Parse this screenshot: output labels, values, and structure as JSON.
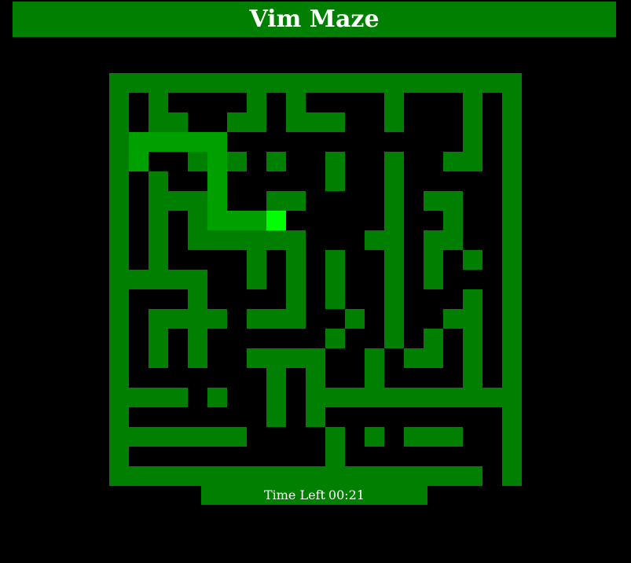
{
  "header": {
    "title": "Vim Maze"
  },
  "timer": {
    "label": "Time Left",
    "value": "00:21"
  },
  "maze": {
    "rows": 21,
    "cols": 21,
    "colors": {
      "wall": "#007f00",
      "floor": "#000000",
      "trail": "#00a000",
      "player": "#00ff00"
    },
    "grid": [
      "#####################",
      "#.#....#.#....#...#.#",
      "#.##..##.###..#...#.#",
      "#.................#.#",
      "#...###.#..#..#..##.#",
      "#.#........#..#.....#",
      "#.###...##....#.##..#",
      "#.#.#.........#..#..#",
      "#.#.######...##.##..#",
      "#.#....#.#.#..#.#.#.#",
      "#####..#.#.#..#.#...#",
      "#...#....#.#..#...#.#",
      "#.####.###..#.#..##.#",
      "#.#.#......#..#.#.#.#",
      "#.#.#..####..#.##.#.#",
      "#.......#.#..#....#.#",
      "####.#..#.############",
      "#.......#.#.........#",
      "#######....#.#.###..#",
      "#..........#........#",
      "###################.#"
    ],
    "trail": [
      [
        3,
        1
      ],
      [
        3,
        2
      ],
      [
        3,
        3
      ],
      [
        3,
        4
      ],
      [
        3,
        5
      ],
      [
        4,
        1
      ],
      [
        4,
        5
      ],
      [
        5,
        5
      ],
      [
        6,
        5
      ],
      [
        7,
        5
      ],
      [
        7,
        6
      ],
      [
        7,
        7
      ],
      [
        7,
        8
      ]
    ],
    "player": {
      "row": 7,
      "col": 8
    }
  }
}
